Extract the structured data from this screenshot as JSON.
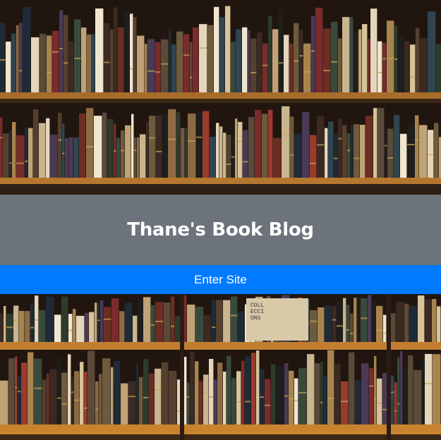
{
  "site": {
    "title": "Thane's Book Blog",
    "enter_label": "Enter Site"
  },
  "background": {
    "image": "bookshelf-photo",
    "book_spine_text": "COLL ECCI ONS"
  },
  "colors": {
    "banner": "#6c737b",
    "enter_button": "#007bff",
    "shelf_wood": "#b5772e",
    "dark_wood": "#2a1c14"
  }
}
